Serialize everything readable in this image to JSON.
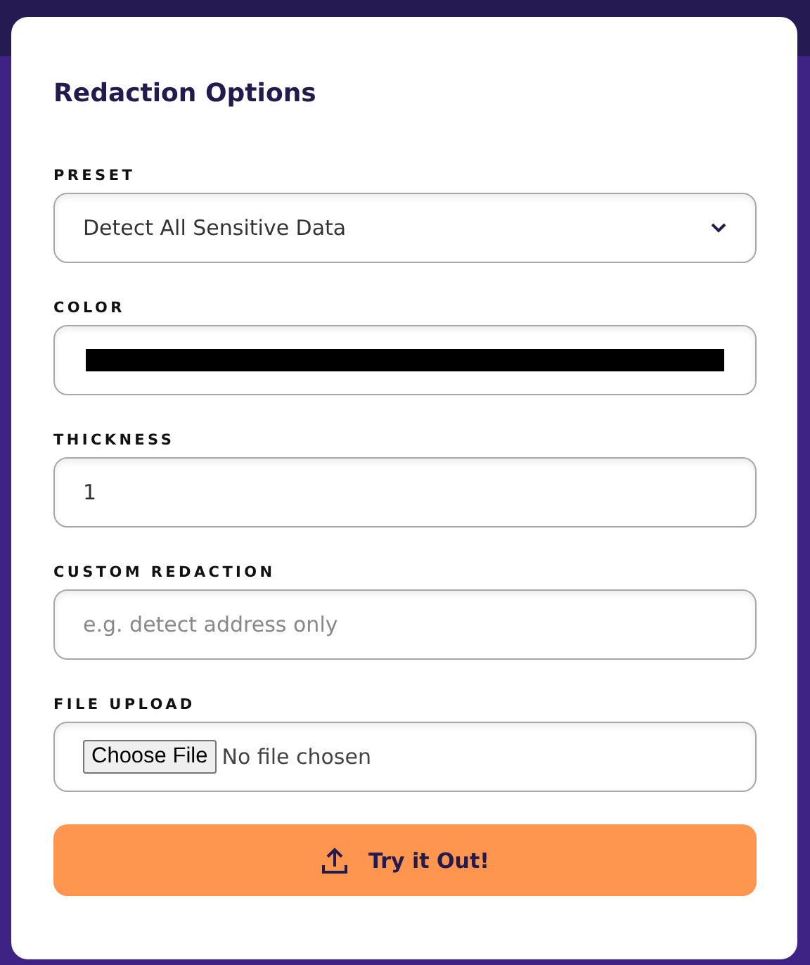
{
  "panel": {
    "title": "Redaction Options"
  },
  "fields": [
    {
      "kind": "select",
      "label": "PRESET",
      "value": "Detect All Sensitive Data"
    },
    {
      "kind": "color",
      "label": "COLOR",
      "color": "#000000"
    },
    {
      "kind": "text",
      "label": "THICKNESS",
      "value": "1"
    },
    {
      "kind": "text",
      "label": "CUSTOM REDACTION",
      "placeholder": "e.g. detect address only"
    },
    {
      "kind": "file",
      "label": "FILE UPLOAD",
      "button": "Choose File",
      "status": "No file chosen"
    }
  ],
  "submit": {
    "label": "Try it Out!"
  }
}
